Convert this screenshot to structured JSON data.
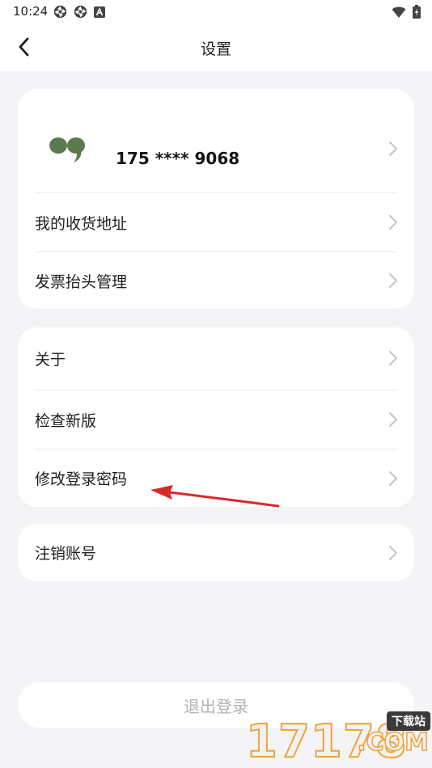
{
  "status_bar": {
    "time": "10:24",
    "left_icons": [
      "aperture-icon",
      "aperture-icon",
      "a-letter-icon"
    ],
    "right_icons": [
      "wifi-icon",
      "battery-icon"
    ]
  },
  "nav": {
    "title": "设置",
    "back_icon": "chevron-left-icon"
  },
  "account": {
    "phone": "175 **** 9068",
    "avatar_icon": "quote-mark-icon",
    "avatar_color": "#5d7a4e"
  },
  "group1": {
    "items": [
      {
        "label": "我的收货地址"
      },
      {
        "label": "发票抬头管理"
      }
    ]
  },
  "group2": {
    "items": [
      {
        "label": "关于"
      },
      {
        "label": "检查新版"
      },
      {
        "label": "修改登录密码"
      }
    ]
  },
  "group3": {
    "items": [
      {
        "label": "注销账号"
      }
    ]
  },
  "logout": {
    "label": "退出登录"
  },
  "watermark": {
    "number": "17178",
    "badge": "下载站",
    "domain": ".COM"
  },
  "colors": {
    "background": "#f4f4f7",
    "card": "#ffffff",
    "annotation_arrow": "#d9282c",
    "watermark_outline": "#f0a33b"
  }
}
